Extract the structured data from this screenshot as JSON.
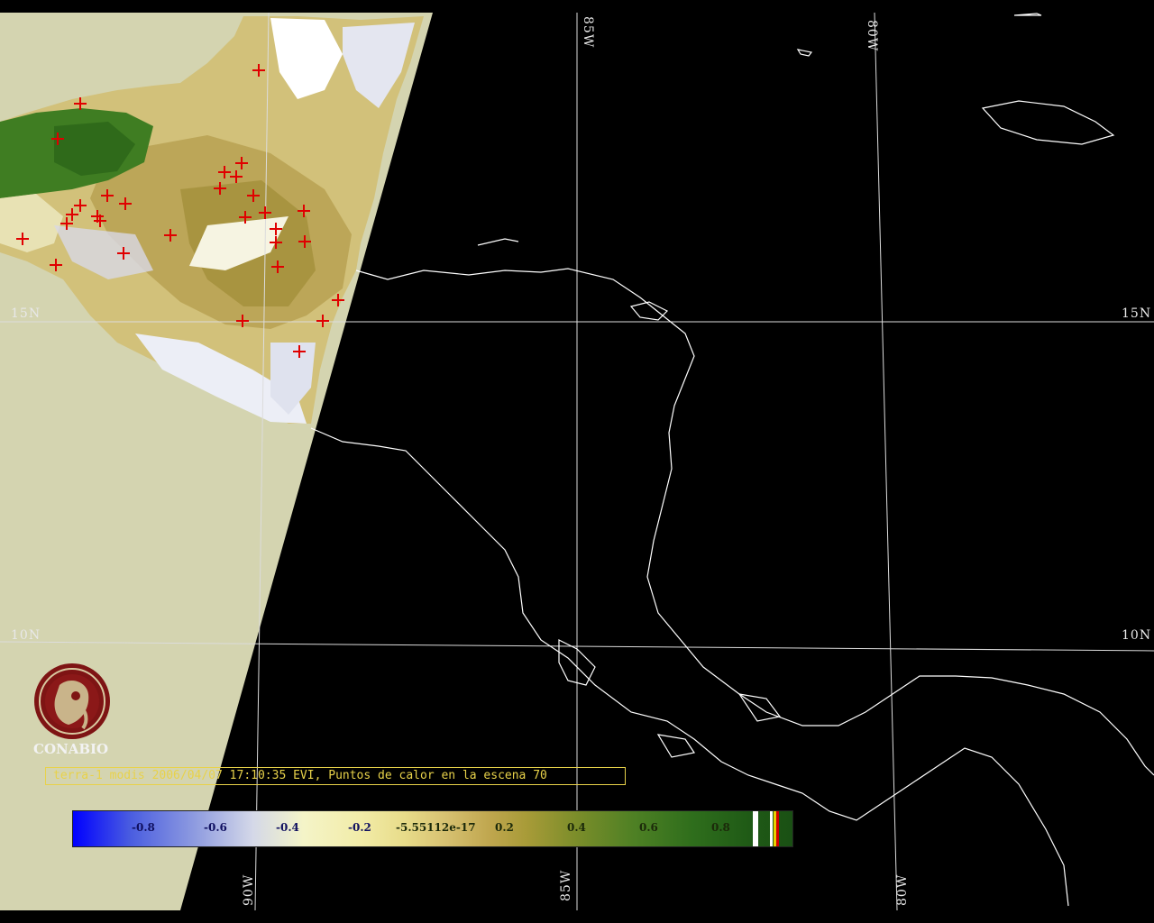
{
  "map": {
    "graticule_labels": {
      "lon_85w_top": "85W",
      "lon_80w_top": "80W",
      "lon_90w_bottom": "90W",
      "lon_85w_bottom": "85W",
      "lon_80w_bottom": "80W",
      "lat_15n_left": "15N",
      "lat_15n_right": "15N",
      "lat_10n_left": "10N",
      "lat_10n_right": "10N"
    },
    "colors": {
      "background": "#000000",
      "outside_swath": "#d4d4b0",
      "coastline": "#ffffff",
      "hotspot": "#e00000",
      "caption": "#e8d24a"
    }
  },
  "logo": {
    "name": "CONABIO"
  },
  "caption": {
    "text": "terra-1 modis 2006/04/07 17:10:35 EVI, Puntos de calor en la escena 70"
  },
  "colorbar": {
    "ticks": [
      "-0.8",
      "-0.6",
      "-0.4",
      "-0.2",
      "-5.55112e-17",
      "0.2",
      "0.4",
      "0.6",
      "0.8"
    ],
    "range": [
      -1.0,
      1.0
    ]
  }
}
